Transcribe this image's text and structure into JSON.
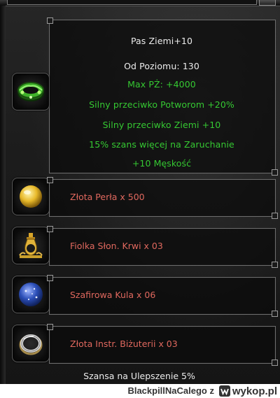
{
  "item": {
    "name": "Pas Ziemi+10",
    "level": "Od Poziomu: 130",
    "bonuses": [
      "Max PŻ: +4000",
      "Silny przeciwko Potworom  +20%",
      "Silny przeciwko Ziemi  +10",
      "15% szans więcej na Zaruchanie",
      "+10 Męskość"
    ],
    "icon": "green-belt-icon"
  },
  "materials": [
    {
      "label": "Złota Perła x 500",
      "icon": "golden-pearl-icon"
    },
    {
      "label": "Fiolka Słon. Krwi x 03",
      "icon": "blood-vial-icon"
    },
    {
      "label": "Szafirowa Kula x 06",
      "icon": "sapphire-orb-icon"
    },
    {
      "label": "Złota Instr. Biżuterii x 03",
      "icon": "silver-ring-icon"
    }
  ],
  "chance": "Szansa na Ulepszenie 5%",
  "footer": {
    "author": "BlackpillNaCalego",
    "separator": "z",
    "site": "wykop.pl"
  },
  "colors": {
    "white_text": "#ececec",
    "green_text": "#35c932",
    "material_text": "#e0685e",
    "panel_border": "#6d6d6d"
  }
}
